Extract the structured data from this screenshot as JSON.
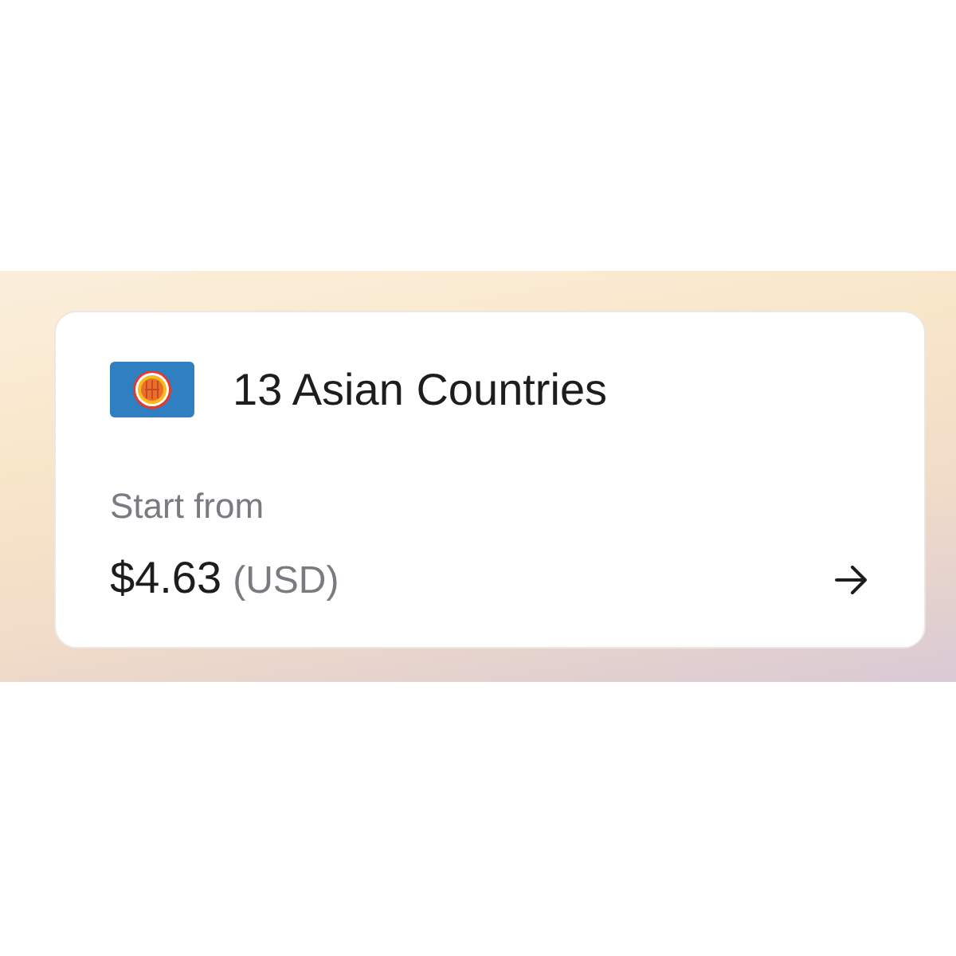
{
  "card": {
    "title": "13 Asian Countries",
    "price_label": "Start from",
    "price": "$4.63",
    "currency": "(USD)"
  }
}
